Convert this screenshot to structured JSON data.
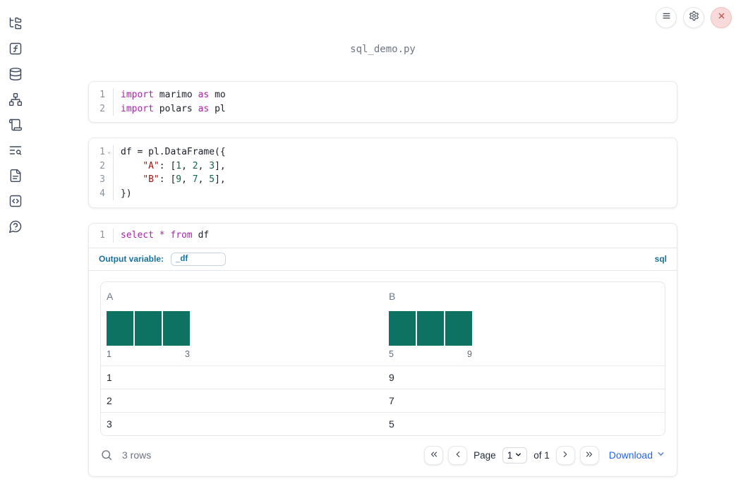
{
  "window": {
    "title": "sql_demo.py"
  },
  "topbar": {
    "buttons": [
      "menu",
      "settings",
      "close"
    ]
  },
  "sidebar": {
    "icons": [
      "file-explorer",
      "functions",
      "datasources",
      "dependency-graph",
      "scratchpad",
      "logs-search",
      "documentation",
      "snippets",
      "help"
    ]
  },
  "cells": [
    {
      "name": "imports-cell",
      "lines": [
        {
          "num": "1",
          "fold": "",
          "tokens": [
            [
              "import",
              "kw"
            ],
            [
              " marimo ",
              "tx"
            ],
            [
              "as",
              "kw"
            ],
            [
              " mo",
              "tx"
            ]
          ]
        },
        {
          "num": "2",
          "fold": "",
          "tokens": [
            [
              "import",
              "kw"
            ],
            [
              " polars ",
              "tx"
            ],
            [
              "as",
              "kw"
            ],
            [
              " pl",
              "tx"
            ]
          ]
        }
      ]
    },
    {
      "name": "dataframe-cell",
      "lines": [
        {
          "num": "1",
          "fold": "v",
          "tokens": [
            [
              "df = pl.DataFrame({",
              "tx"
            ]
          ]
        },
        {
          "num": "2",
          "fold": "",
          "tokens": [
            [
              "    ",
              "tx"
            ],
            [
              "\"A\"",
              "str"
            ],
            [
              ": [",
              "tx"
            ],
            [
              "1",
              "num"
            ],
            [
              ", ",
              "tx"
            ],
            [
              "2",
              "num"
            ],
            [
              ", ",
              "tx"
            ],
            [
              "3",
              "num"
            ],
            [
              "],",
              "tx"
            ]
          ]
        },
        {
          "num": "3",
          "fold": "",
          "tokens": [
            [
              "    ",
              "tx"
            ],
            [
              "\"B\"",
              "str"
            ],
            [
              ": [",
              "tx"
            ],
            [
              "9",
              "num"
            ],
            [
              ", ",
              "tx"
            ],
            [
              "7",
              "num"
            ],
            [
              ", ",
              "tx"
            ],
            [
              "5",
              "num"
            ],
            [
              "],",
              "tx"
            ]
          ]
        },
        {
          "num": "4",
          "fold": "",
          "tokens": [
            [
              "})",
              "tx"
            ]
          ]
        }
      ]
    },
    {
      "name": "sql-cell",
      "lines": [
        {
          "num": "1",
          "fold": "",
          "tokens": [
            [
              "select",
              "kw"
            ],
            [
              " ",
              "tx"
            ],
            [
              "*",
              "kw"
            ],
            [
              " ",
              "tx"
            ],
            [
              "from",
              "kw"
            ],
            [
              " df",
              "tx"
            ]
          ]
        }
      ]
    }
  ],
  "sql_meta": {
    "output_variable_label": "Output variable:",
    "output_variable_value": "_df",
    "language_badge": "sql"
  },
  "table": {
    "bar_color": "#0e7263",
    "columns": [
      {
        "name": "A",
        "histogram": {
          "bars": [
            1,
            1,
            1
          ],
          "min_label": "1",
          "max_label": "3"
        }
      },
      {
        "name": "B",
        "histogram": {
          "bars": [
            1,
            1,
            1
          ],
          "min_label": "5",
          "max_label": "9"
        }
      }
    ],
    "rows": [
      [
        "1",
        "9"
      ],
      [
        "2",
        "7"
      ],
      [
        "3",
        "5"
      ]
    ]
  },
  "table_footer": {
    "row_count": "3 rows",
    "page_label": "Page",
    "page_value": "1",
    "of_label": "of 1",
    "download_label": "Download"
  },
  "colors": {
    "accent_blue": "#17719c",
    "link_blue": "#2563eb",
    "keyword": "#a626a4",
    "string": "#a31515",
    "number": "#116644",
    "histogram_bar": "#0e7263"
  }
}
